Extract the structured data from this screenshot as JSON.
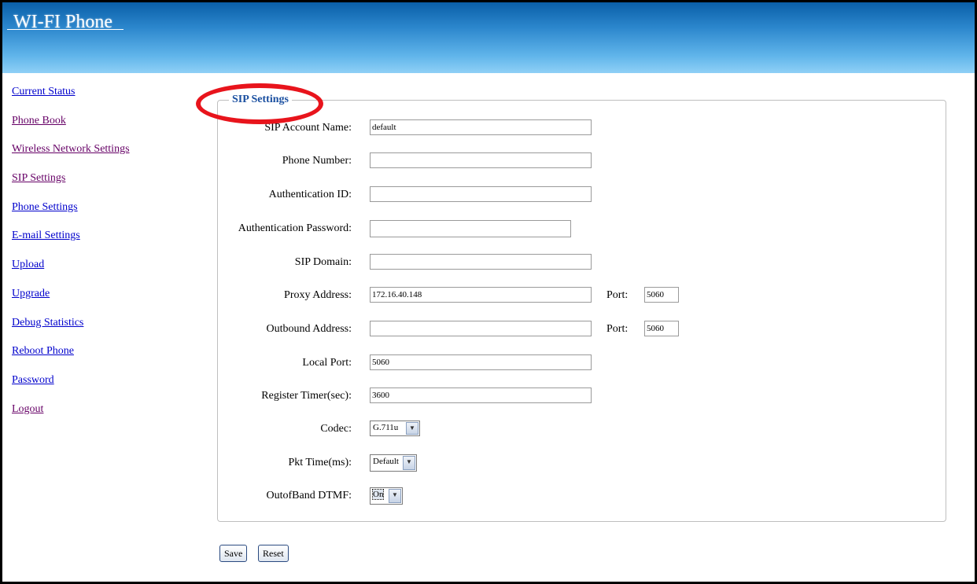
{
  "header": {
    "title": "WI-FI Phone"
  },
  "sidebar": {
    "items": [
      {
        "label": "Current Status"
      },
      {
        "label": "Phone Book"
      },
      {
        "label": "Wireless Network Settings"
      },
      {
        "label": "SIP Settings"
      },
      {
        "label": "Phone Settings"
      },
      {
        "label": "E-mail Settings"
      },
      {
        "label": "Upload"
      },
      {
        "label": "Upgrade"
      },
      {
        "label": "Debug Statistics"
      },
      {
        "label": "Reboot Phone"
      },
      {
        "label": "Password"
      },
      {
        "label": "Logout"
      }
    ]
  },
  "form": {
    "legend": "SIP Settings",
    "fields": {
      "account_name": {
        "label": "SIP Account Name:",
        "value": "default"
      },
      "phone_number": {
        "label": "Phone Number:",
        "value": ""
      },
      "auth_id": {
        "label": "Authentication ID:",
        "value": ""
      },
      "auth_password": {
        "label": "Authentication Password:",
        "value": ""
      },
      "sip_domain": {
        "label": "SIP Domain:",
        "value": ""
      },
      "proxy_address": {
        "label": "Proxy Address:",
        "value": "172.16.40.148",
        "port_label": "Port:",
        "port": "5060"
      },
      "outbound_address": {
        "label": "Outbound Address:",
        "value": "",
        "port_label": "Port:",
        "port": "5060"
      },
      "local_port": {
        "label": "Local Port:",
        "value": "5060"
      },
      "register_timer": {
        "label": "Register Timer(sec):",
        "value": "3600"
      },
      "codec": {
        "label": "Codec:",
        "value": "G.711u"
      },
      "pkt_time": {
        "label": "Pkt Time(ms):",
        "value": "Default"
      },
      "dtmf": {
        "label": "OutofBand DTMF:",
        "value": "On"
      }
    }
  },
  "buttons": {
    "save": "Save",
    "reset": "Reset"
  },
  "colors": {
    "banner_top": "#0a5fa8",
    "banner_bottom": "#8fd0f6",
    "annotation": "#e8141c",
    "legend": "#1a4fa0"
  }
}
